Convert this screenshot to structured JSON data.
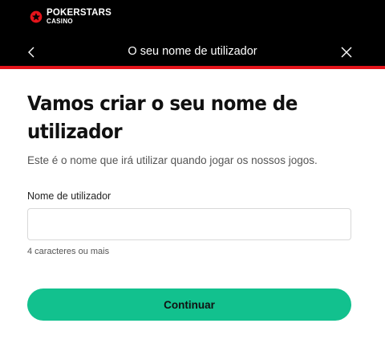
{
  "brand": {
    "name": "POKERSTARS",
    "subname": "CASINO",
    "star_color": "#e4141b"
  },
  "header": {
    "title": "O seu nome de utilizador",
    "back_icon": "chevron-left-icon",
    "close_icon": "close-icon",
    "accent_line_color": "#e4141b"
  },
  "main": {
    "heading": "Vamos criar o seu nome de utilizador",
    "subtitle": "Este é o nome que irá utilizar quando jogar os nossos jogos.",
    "username_field": {
      "label": "Nome de utilizador",
      "value": "",
      "placeholder": "",
      "hint": "4 caracteres ou mais"
    },
    "continue_button": {
      "label": "Continuar",
      "color": "#12c18e"
    }
  }
}
